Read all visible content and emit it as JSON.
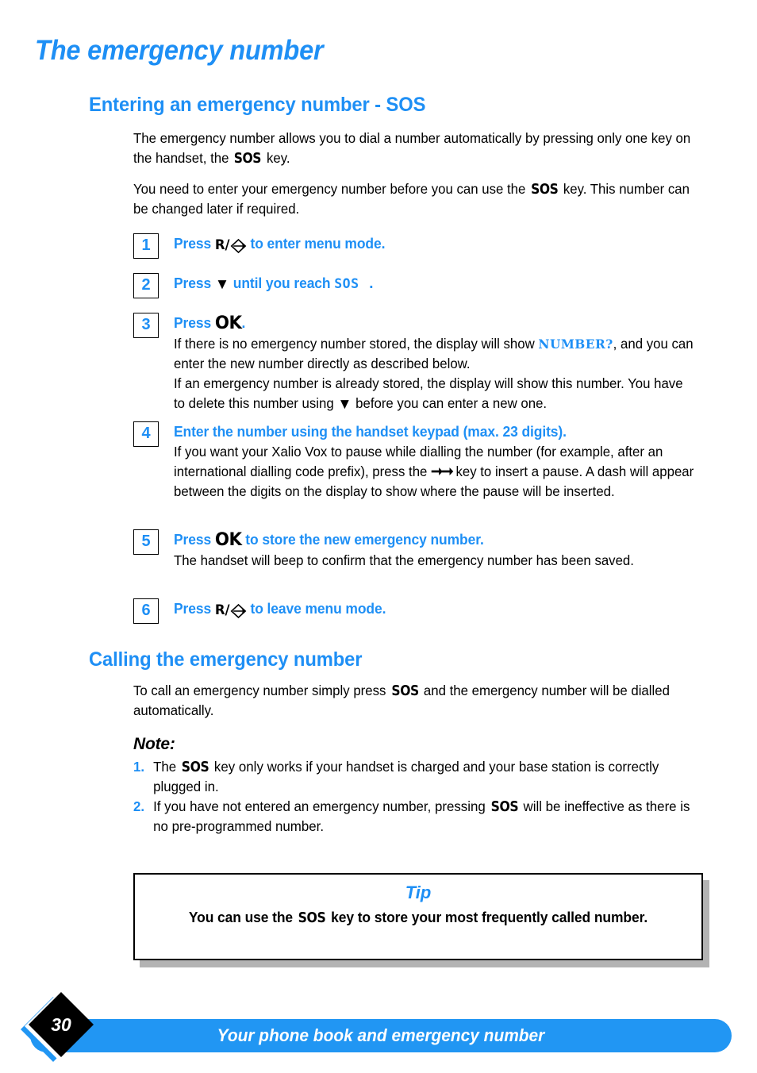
{
  "document": {
    "title": "The emergency number",
    "accent_color": "#1E8FF5",
    "footer_bar_color": "#2196F3"
  },
  "section_entering": {
    "heading": "Entering an emergency number - SOS",
    "intro": [
      {
        "pre": "The emergency number allows you to dial a number automatically by pressing only one key on the handset, the ",
        "key": "SOS",
        "post": " key."
      },
      {
        "pre": "You need to enter your emergency number before you can use the ",
        "key": "SOS",
        "post": " key.  This number can be changed later if required."
      }
    ],
    "steps": [
      {
        "number": "1",
        "head_pre": "Press ",
        "key_label": "R/",
        "key_icon": "menu-diamond-arrow-icon",
        "head_post": " to enter menu mode.",
        "sub": []
      },
      {
        "number": "2",
        "head_pre": "Press ",
        "key_icon": "down-triangle-icon",
        "head_mid": " until you reach ",
        "lcd": "SOS .",
        "sub": []
      },
      {
        "number": "3",
        "head_pre": "Press ",
        "ok_key": "OK",
        "head_post": ".",
        "sub_line_1_pre": "If there is no emergency number stored, the display will show ",
        "sub_line_1_lcd": "NUMBER?",
        "sub_line_1_post": ", and you can enter the new number directly as described below.",
        "sub_line_2_pre": "If an emergency number is already stored, the display will show this number. You have to delete this number using ",
        "sub_line_2_icon": "down-triangle-icon",
        "sub_line_2_post": " before you can enter a new one."
      },
      {
        "number": "4",
        "head": "Enter the number using the handset keypad (max. 23 digits).",
        "sub_pre": "If you want your Xalio Vox to pause while dialling the number (for example, after an international dialling code prefix), press the ",
        "sub_icon": "double-right-arrow-icon",
        "sub_post": " key to insert a pause.  A dash will appear between the digits on the display to show where the pause will be inserted."
      },
      {
        "number": "5",
        "head_pre": "Press ",
        "ok_key": "OK",
        "head_post": " to store the new emergency number.",
        "sub": "The handset will beep to confirm that the emergency number has been saved."
      },
      {
        "number": "6",
        "head_pre": "Press ",
        "key_label": "R/",
        "key_icon": "menu-diamond-arrow-icon",
        "head_post": " to leave menu mode.",
        "sub": []
      }
    ]
  },
  "section_calling": {
    "heading": "Calling the emergency number",
    "paragraph_pre": "To call an emergency number simply press ",
    "paragraph_key": "SOS",
    "paragraph_post": " and the emergency number will be dialled automatically."
  },
  "note": {
    "title": "Note:",
    "items": [
      {
        "marker": "1.",
        "pre": "The ",
        "key": "SOS",
        "post": " key only works if your handset is charged and your base station is correctly plugged in."
      },
      {
        "marker": "2.",
        "pre": "If you have not entered an emergency number, pressing ",
        "key": "SOS",
        "post": " will be ineffective as there is no pre-programmed number."
      }
    ]
  },
  "tip": {
    "title": "Tip",
    "text_pre": "You can use the ",
    "text_key": "SOS",
    "text_post": " key to store your most frequently called number."
  },
  "footer": {
    "page_number": "30",
    "title": "Your phone book and emergency number"
  }
}
